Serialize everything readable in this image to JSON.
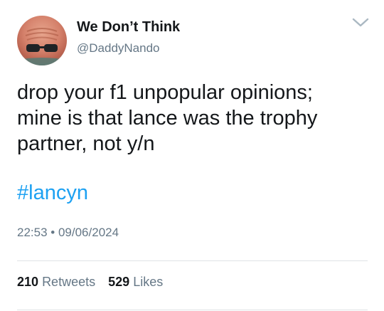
{
  "author": {
    "display_name": "We Don’t Think",
    "handle": "@DaddyNando"
  },
  "tweet": {
    "lines": [
      "drop your f1 unpopular opinions;",
      "mine is that lance was the trophy",
      "partner, not y/n"
    ],
    "hashtag": "#lancyn",
    "time": "22:53",
    "separator": "•",
    "date": "09/06/2024"
  },
  "stats": {
    "retweets_count": "210",
    "retweets_label": "Retweets",
    "likes_count": "529",
    "likes_label": "Likes"
  },
  "icons": {
    "menu": "chevron-down-icon"
  },
  "colors": {
    "link": "#1da1f2",
    "secondary_text": "#657786",
    "primary_text": "#14171a",
    "divider": "#dfe3e6"
  }
}
